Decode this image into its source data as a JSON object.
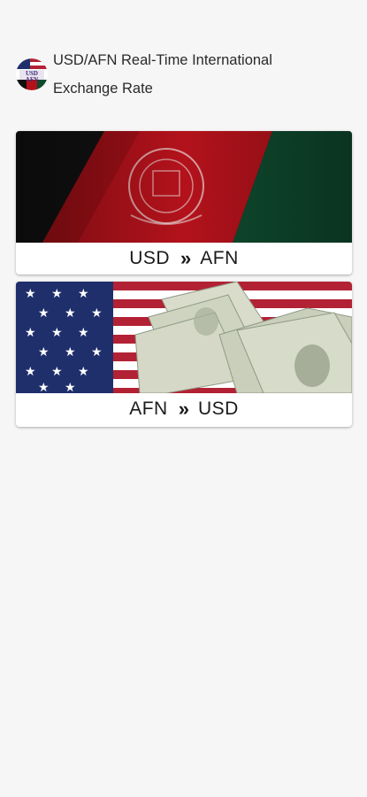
{
  "header": {
    "title": "USD/AFN Real-Time International Exchange Rate",
    "logo_icon": "usd-afn-logo-icon",
    "logo_text_top": "USD",
    "logo_text_bottom": "AFN"
  },
  "cards": [
    {
      "from": "USD",
      "separator": "»",
      "to": "AFN",
      "image": "afghanistan-flag-image"
    },
    {
      "from": "AFN",
      "separator": "»",
      "to": "USD",
      "image": "us-flag-dollars-image"
    }
  ],
  "colors": {
    "background": "#f6f6f6",
    "card": "#ffffff",
    "afghan_black": "#111111",
    "afghan_red": "#b3121b",
    "afghan_green": "#0f4a2e",
    "us_blue": "#1f2f6b",
    "us_red": "#b22234"
  }
}
